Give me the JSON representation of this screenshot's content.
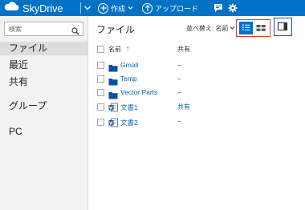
{
  "app": {
    "brand": "SkyDrive"
  },
  "toolbar": {
    "create_label": "作成",
    "upload_label": "アップロード"
  },
  "search": {
    "placeholder": "検索"
  },
  "sidebar": {
    "items": [
      {
        "label": "ファイル",
        "active": true
      },
      {
        "label": "最近"
      },
      {
        "label": "共有"
      },
      {
        "label": "グループ"
      },
      {
        "label": "PC"
      }
    ]
  },
  "main": {
    "title": "ファイル",
    "sort_label": "並べ替え: 名前",
    "columns": {
      "name": "名前",
      "sort_indicator": "↑",
      "shared": "共有"
    },
    "rows": [
      {
        "name": "Gmail",
        "type": "folder",
        "shared": "–"
      },
      {
        "name": "Temp",
        "type": "folder",
        "shared": "–"
      },
      {
        "name": "Vector Parts",
        "type": "folder",
        "shared": "–"
      },
      {
        "name": "文書1",
        "type": "word-doc",
        "shared": "共有"
      },
      {
        "name": "文書2",
        "type": "word-doc",
        "shared": "–"
      }
    ]
  },
  "colors": {
    "topbar": "#0072c6",
    "link": "#0063b1",
    "view_group_outline": "#e53935",
    "details_outline": "#1e4fd8"
  }
}
